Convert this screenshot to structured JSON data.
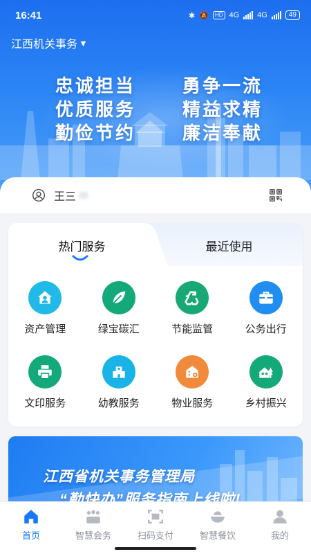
{
  "status_bar": {
    "time": "16:41",
    "network": "4G",
    "network2": "4G",
    "hd": "HD",
    "battery": "49"
  },
  "banner": {
    "region": "江西机关事务",
    "region_dropdown_icon": "triangle-down-icon",
    "slogans": [
      [
        "忠诚担当",
        "勇争一流"
      ],
      [
        "优质服务",
        "精益求精"
      ],
      [
        "勤俭节约",
        "廉洁奉献"
      ]
    ]
  },
  "user": {
    "name": "王三",
    "avatar_icon": "user-circle-icon",
    "qr_icon": "qr-code-icon"
  },
  "services": {
    "tabs": [
      {
        "label": "热门服务",
        "active": true
      },
      {
        "label": "最近使用",
        "active": false
      }
    ],
    "items": [
      {
        "label": "资产管理",
        "icon": "house-person-icon",
        "color": "#20b9e8"
      },
      {
        "label": "绿宝碳汇",
        "icon": "leaf-icon",
        "color": "#14a978"
      },
      {
        "label": "节能监管",
        "icon": "recycle-icon",
        "color": "#18a875"
      },
      {
        "label": "公务出行",
        "icon": "briefcase-icon",
        "color": "#1f8ef0"
      },
      {
        "label": "文印服务",
        "icon": "printer-icon",
        "color": "#14a978"
      },
      {
        "label": "幼教服务",
        "icon": "school-icon",
        "color": "#1ab3e8"
      },
      {
        "label": "物业服务",
        "icon": "building-gear-icon",
        "color": "#f28a3c"
      },
      {
        "label": "乡村振兴",
        "icon": "village-icon",
        "color": "#14a978"
      }
    ]
  },
  "promo": {
    "title": "江西省机关事务管理局",
    "subtitle": "“勤快办”服务指南上线啦!"
  },
  "bottom_nav": [
    {
      "label": "首页",
      "icon": "home-icon",
      "active": true
    },
    {
      "label": "智慧会务",
      "icon": "meeting-icon",
      "active": false
    },
    {
      "label": "扫码支付",
      "icon": "scan-icon",
      "active": false
    },
    {
      "label": "智慧餐饮",
      "icon": "dining-icon",
      "active": false
    },
    {
      "label": "我的",
      "icon": "profile-icon",
      "active": false
    }
  ],
  "colors": {
    "accent": "#1677ff",
    "banner_top": "#1d6ef0",
    "nav_inactive": "#8d9199"
  }
}
